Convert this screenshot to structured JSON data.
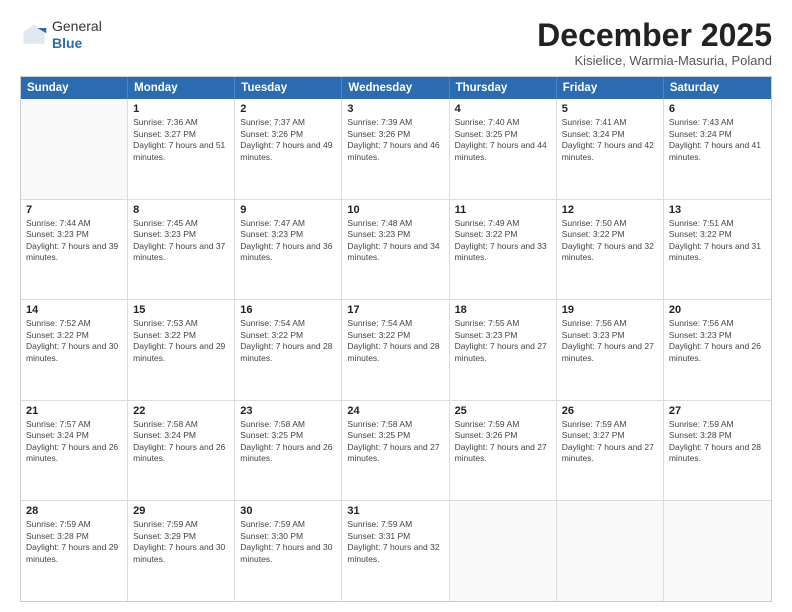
{
  "logo": {
    "general": "General",
    "blue": "Blue"
  },
  "header": {
    "month": "December 2025",
    "location": "Kisielice, Warmia-Masuria, Poland"
  },
  "days": [
    "Sunday",
    "Monday",
    "Tuesday",
    "Wednesday",
    "Thursday",
    "Friday",
    "Saturday"
  ],
  "weeks": [
    [
      {
        "day": "",
        "empty": true
      },
      {
        "day": "1",
        "sunrise": "Sunrise: 7:36 AM",
        "sunset": "Sunset: 3:27 PM",
        "daylight": "Daylight: 7 hours and 51 minutes."
      },
      {
        "day": "2",
        "sunrise": "Sunrise: 7:37 AM",
        "sunset": "Sunset: 3:26 PM",
        "daylight": "Daylight: 7 hours and 49 minutes."
      },
      {
        "day": "3",
        "sunrise": "Sunrise: 7:39 AM",
        "sunset": "Sunset: 3:26 PM",
        "daylight": "Daylight: 7 hours and 46 minutes."
      },
      {
        "day": "4",
        "sunrise": "Sunrise: 7:40 AM",
        "sunset": "Sunset: 3:25 PM",
        "daylight": "Daylight: 7 hours and 44 minutes."
      },
      {
        "day": "5",
        "sunrise": "Sunrise: 7:41 AM",
        "sunset": "Sunset: 3:24 PM",
        "daylight": "Daylight: 7 hours and 42 minutes."
      },
      {
        "day": "6",
        "sunrise": "Sunrise: 7:43 AM",
        "sunset": "Sunset: 3:24 PM",
        "daylight": "Daylight: 7 hours and 41 minutes."
      }
    ],
    [
      {
        "day": "7",
        "sunrise": "Sunrise: 7:44 AM",
        "sunset": "Sunset: 3:23 PM",
        "daylight": "Daylight: 7 hours and 39 minutes."
      },
      {
        "day": "8",
        "sunrise": "Sunrise: 7:45 AM",
        "sunset": "Sunset: 3:23 PM",
        "daylight": "Daylight: 7 hours and 37 minutes."
      },
      {
        "day": "9",
        "sunrise": "Sunrise: 7:47 AM",
        "sunset": "Sunset: 3:23 PM",
        "daylight": "Daylight: 7 hours and 36 minutes."
      },
      {
        "day": "10",
        "sunrise": "Sunrise: 7:48 AM",
        "sunset": "Sunset: 3:23 PM",
        "daylight": "Daylight: 7 hours and 34 minutes."
      },
      {
        "day": "11",
        "sunrise": "Sunrise: 7:49 AM",
        "sunset": "Sunset: 3:22 PM",
        "daylight": "Daylight: 7 hours and 33 minutes."
      },
      {
        "day": "12",
        "sunrise": "Sunrise: 7:50 AM",
        "sunset": "Sunset: 3:22 PM",
        "daylight": "Daylight: 7 hours and 32 minutes."
      },
      {
        "day": "13",
        "sunrise": "Sunrise: 7:51 AM",
        "sunset": "Sunset: 3:22 PM",
        "daylight": "Daylight: 7 hours and 31 minutes."
      }
    ],
    [
      {
        "day": "14",
        "sunrise": "Sunrise: 7:52 AM",
        "sunset": "Sunset: 3:22 PM",
        "daylight": "Daylight: 7 hours and 30 minutes."
      },
      {
        "day": "15",
        "sunrise": "Sunrise: 7:53 AM",
        "sunset": "Sunset: 3:22 PM",
        "daylight": "Daylight: 7 hours and 29 minutes."
      },
      {
        "day": "16",
        "sunrise": "Sunrise: 7:54 AM",
        "sunset": "Sunset: 3:22 PM",
        "daylight": "Daylight: 7 hours and 28 minutes."
      },
      {
        "day": "17",
        "sunrise": "Sunrise: 7:54 AM",
        "sunset": "Sunset: 3:22 PM",
        "daylight": "Daylight: 7 hours and 28 minutes."
      },
      {
        "day": "18",
        "sunrise": "Sunrise: 7:55 AM",
        "sunset": "Sunset: 3:23 PM",
        "daylight": "Daylight: 7 hours and 27 minutes."
      },
      {
        "day": "19",
        "sunrise": "Sunrise: 7:56 AM",
        "sunset": "Sunset: 3:23 PM",
        "daylight": "Daylight: 7 hours and 27 minutes."
      },
      {
        "day": "20",
        "sunrise": "Sunrise: 7:56 AM",
        "sunset": "Sunset: 3:23 PM",
        "daylight": "Daylight: 7 hours and 26 minutes."
      }
    ],
    [
      {
        "day": "21",
        "sunrise": "Sunrise: 7:57 AM",
        "sunset": "Sunset: 3:24 PM",
        "daylight": "Daylight: 7 hours and 26 minutes."
      },
      {
        "day": "22",
        "sunrise": "Sunrise: 7:58 AM",
        "sunset": "Sunset: 3:24 PM",
        "daylight": "Daylight: 7 hours and 26 minutes."
      },
      {
        "day": "23",
        "sunrise": "Sunrise: 7:58 AM",
        "sunset": "Sunset: 3:25 PM",
        "daylight": "Daylight: 7 hours and 26 minutes."
      },
      {
        "day": "24",
        "sunrise": "Sunrise: 7:58 AM",
        "sunset": "Sunset: 3:25 PM",
        "daylight": "Daylight: 7 hours and 27 minutes."
      },
      {
        "day": "25",
        "sunrise": "Sunrise: 7:59 AM",
        "sunset": "Sunset: 3:26 PM",
        "daylight": "Daylight: 7 hours and 27 minutes."
      },
      {
        "day": "26",
        "sunrise": "Sunrise: 7:59 AM",
        "sunset": "Sunset: 3:27 PM",
        "daylight": "Daylight: 7 hours and 27 minutes."
      },
      {
        "day": "27",
        "sunrise": "Sunrise: 7:59 AM",
        "sunset": "Sunset: 3:28 PM",
        "daylight": "Daylight: 7 hours and 28 minutes."
      }
    ],
    [
      {
        "day": "28",
        "sunrise": "Sunrise: 7:59 AM",
        "sunset": "Sunset: 3:28 PM",
        "daylight": "Daylight: 7 hours and 29 minutes."
      },
      {
        "day": "29",
        "sunrise": "Sunrise: 7:59 AM",
        "sunset": "Sunset: 3:29 PM",
        "daylight": "Daylight: 7 hours and 30 minutes."
      },
      {
        "day": "30",
        "sunrise": "Sunrise: 7:59 AM",
        "sunset": "Sunset: 3:30 PM",
        "daylight": "Daylight: 7 hours and 30 minutes."
      },
      {
        "day": "31",
        "sunrise": "Sunrise: 7:59 AM",
        "sunset": "Sunset: 3:31 PM",
        "daylight": "Daylight: 7 hours and 32 minutes."
      },
      {
        "day": "",
        "empty": true
      },
      {
        "day": "",
        "empty": true
      },
      {
        "day": "",
        "empty": true
      }
    ]
  ]
}
